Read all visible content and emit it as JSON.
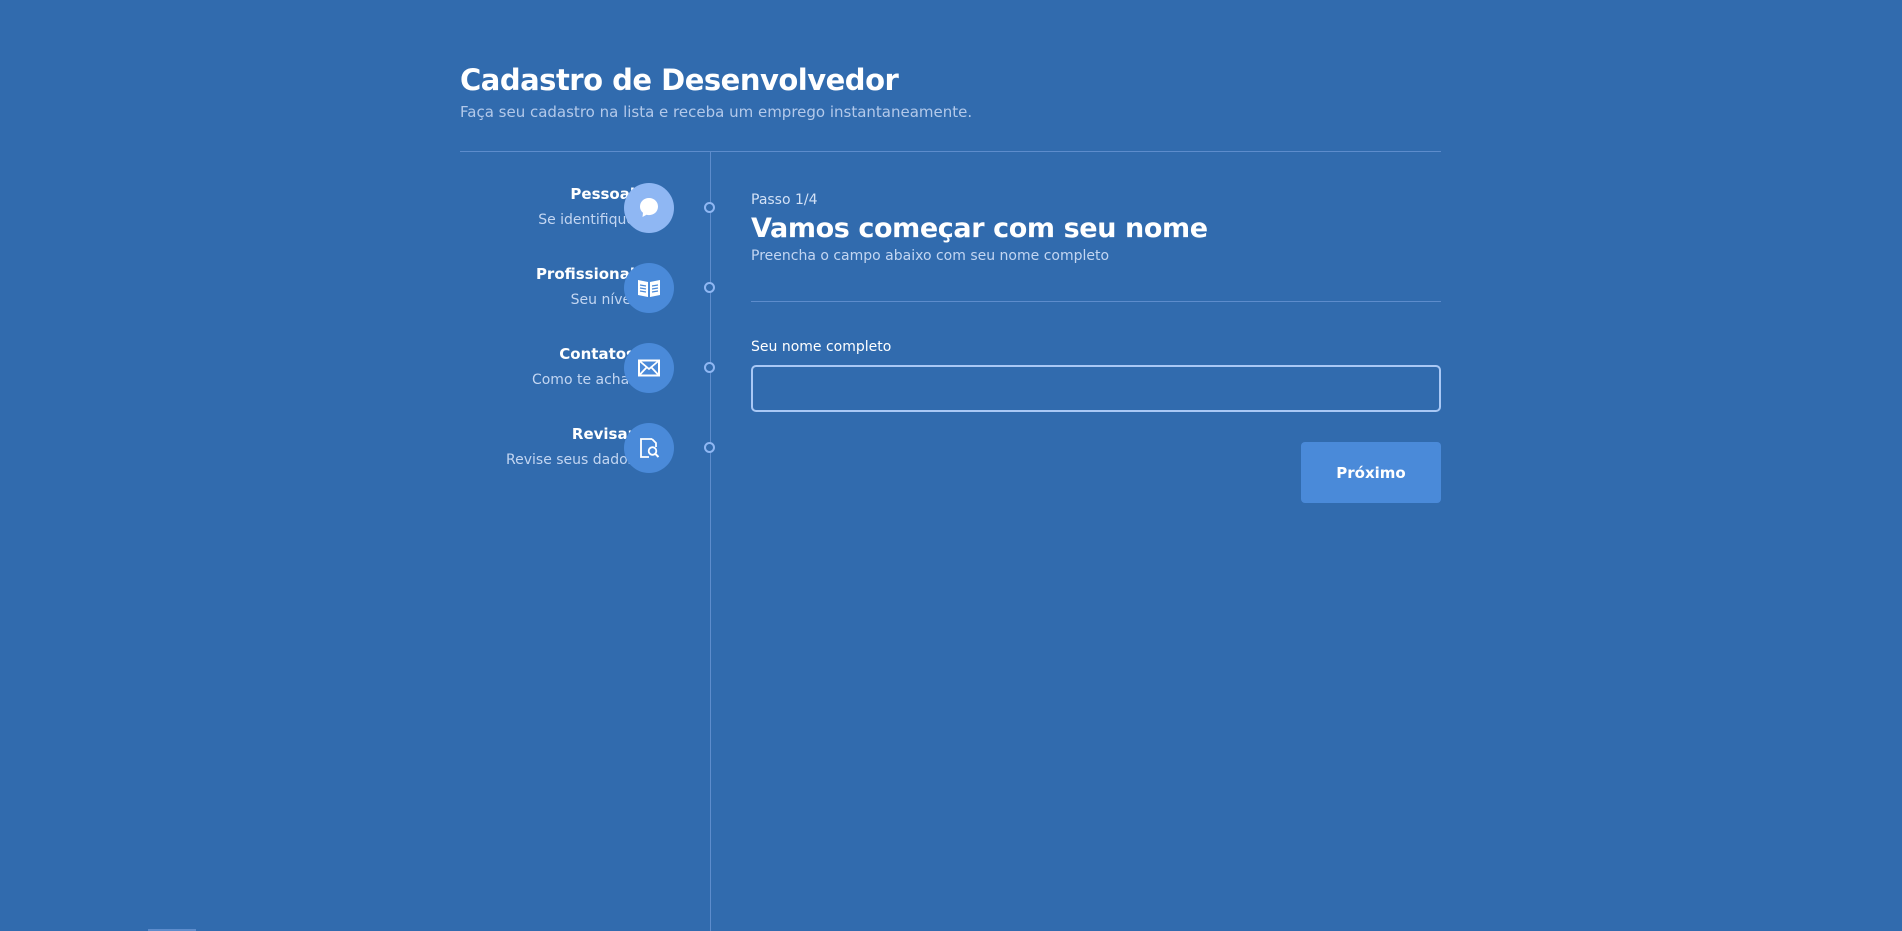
{
  "header": {
    "title": "Cadastro de Desenvolvedor",
    "subtitle": "Faça seu cadastro na lista e receba um emprego instantaneamente."
  },
  "steps": [
    {
      "title": "Pessoal",
      "description": "Se identifique",
      "icon": "user-head-icon",
      "active": true
    },
    {
      "title": "Profissional",
      "description": "Seu nível",
      "icon": "book-icon",
      "active": false
    },
    {
      "title": "Contatos",
      "description": "Como te achar",
      "icon": "mail-icon",
      "active": false
    },
    {
      "title": "Revisar",
      "description": "Revise seus dados",
      "icon": "document-search-icon",
      "active": false
    }
  ],
  "content": {
    "step_count": "Passo 1/4",
    "title": "Vamos começar com seu nome",
    "subtitle": "Preencha o campo abaixo com seu nome completo",
    "field_label": "Seu nome completo",
    "field_value": "",
    "next_label": "Próximo"
  },
  "colors": {
    "background": "#316bae",
    "accent": "#4a8ad9",
    "active_step": "#8fb7f3",
    "divider": "#5d8ccc"
  }
}
